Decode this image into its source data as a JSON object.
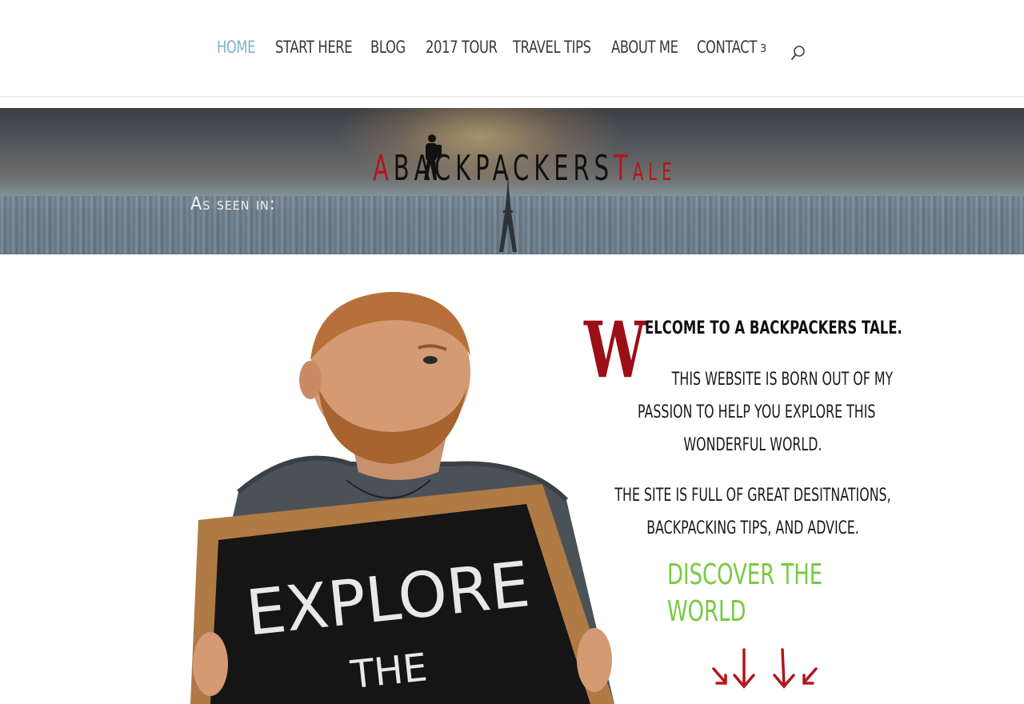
{
  "nav": {
    "items": [
      {
        "label": "HOME",
        "active": true
      },
      {
        "label": "START HERE"
      },
      {
        "label": "BLOG"
      },
      {
        "label": "2017 TOUR"
      },
      {
        "label": "TRAVEL TIPS"
      },
      {
        "label": "ABOUT ME"
      },
      {
        "label": "CONTACT",
        "dropdown": true
      }
    ],
    "chevron": "3",
    "search_icon": "search-icon"
  },
  "hero": {
    "logo": {
      "first": "A",
      "middle": "BACKPACKERS",
      "last_initial": "T",
      "last_rest": "ALE"
    },
    "as_seen_in": "As seen in:"
  },
  "photo": {
    "chalkboard_line1": "EXPLORE",
    "chalkboard_line2": "THE"
  },
  "welcome": {
    "dropcap": "W",
    "headline": "ELCOME TO A BACKPACKERS TALE.",
    "p1_line1": "THIS WEBSITE IS BORN OUT OF MY",
    "p1_line2": "PASSION TO HELP YOU EXPLORE THIS",
    "p1_line3": "WONDERFUL WORLD.",
    "p2_line1": "THE SITE IS FULL OF GREAT DESITNATIONS,",
    "p2_line2": "BACKPACKING TIPS, AND ADVICE.",
    "discover_line1": "DISCOVER THE",
    "discover_line2": "WORLD"
  },
  "colors": {
    "nav_active": "#7eb3c8",
    "dropcap_red": "#9b0f16",
    "logo_red": "#b3161b",
    "discover_green": "#7ac943"
  }
}
